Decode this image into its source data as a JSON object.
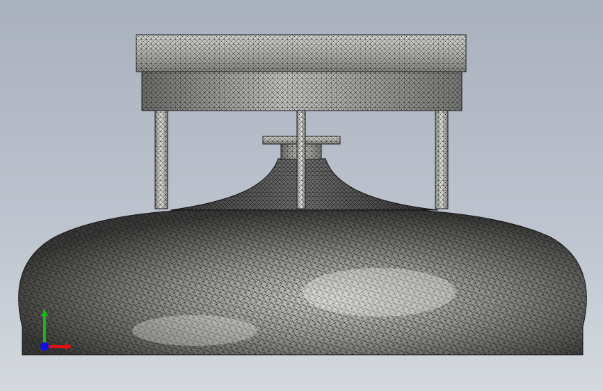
{
  "viewport": {
    "background_top": "#a9b1bd",
    "background_bottom": "#d5d9df",
    "mesh_color": "#1a1a1a",
    "surface_light": "#ededea",
    "surface_dark": "#2a2a2a"
  },
  "model": {
    "parts": [
      "top-plate",
      "lower-ring",
      "support-rod-left",
      "support-rod-center",
      "support-rod-right",
      "nozzle-flange",
      "funnel-neck",
      "dome-tank"
    ]
  },
  "triad": {
    "x_label": "X",
    "y_label": "Y",
    "x_color": "#e01010",
    "y_color": "#18b818",
    "z_color": "#1010e0"
  }
}
